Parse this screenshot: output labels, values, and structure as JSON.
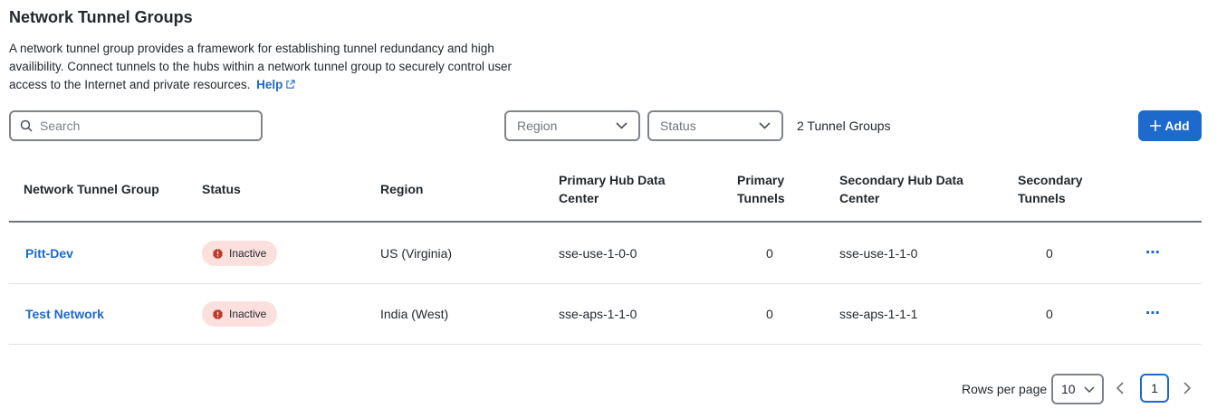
{
  "page": {
    "title": "Network Tunnel Groups",
    "description": "A network tunnel group provides a framework for establishing tunnel redundancy and high availibility. Connect tunnels to the hubs within a network tunnel group to securely control user access to the Internet and private resources.",
    "help_label": "Help"
  },
  "toolbar": {
    "search_placeholder": "Search",
    "region_placeholder": "Region",
    "status_placeholder": "Status",
    "count_text": "2 Tunnel Groups",
    "add_label": "Add"
  },
  "table": {
    "columns": [
      "Network Tunnel Group",
      "Status",
      "Region",
      "Primary Hub Data Center",
      "Primary Tunnels",
      "Secondary Hub Data Center",
      "Secondary Tunnels"
    ],
    "rows": [
      {
        "name": "Pitt-Dev",
        "status": "Inactive",
        "region": "US (Virginia)",
        "primary_hub": "sse-use-1-0-0",
        "primary_tunnels": "0",
        "secondary_hub": "sse-use-1-1-0",
        "secondary_tunnels": "0",
        "actions": "⋯"
      },
      {
        "name": "Test Network",
        "status": "Inactive",
        "region": "India (West)",
        "primary_hub": "sse-aps-1-1-0",
        "primary_tunnels": "0",
        "secondary_hub": "sse-aps-1-1-1",
        "secondary_tunnels": "0",
        "actions": "⋯"
      }
    ]
  },
  "pagination": {
    "rows_per_page_label": "Rows per page",
    "rows_per_page_value": "10",
    "current_page": "1"
  },
  "colors": {
    "accent": "#1d69cc",
    "inactive_badge_bg": "#fbe0dd",
    "inactive_icon": "#c0392b"
  },
  "icons": {
    "search": "search-icon",
    "external": "external-link-icon",
    "chevron": "chevron-down-icon",
    "status": "alert-hexagon-icon",
    "more": "more-horizontal-icon"
  }
}
